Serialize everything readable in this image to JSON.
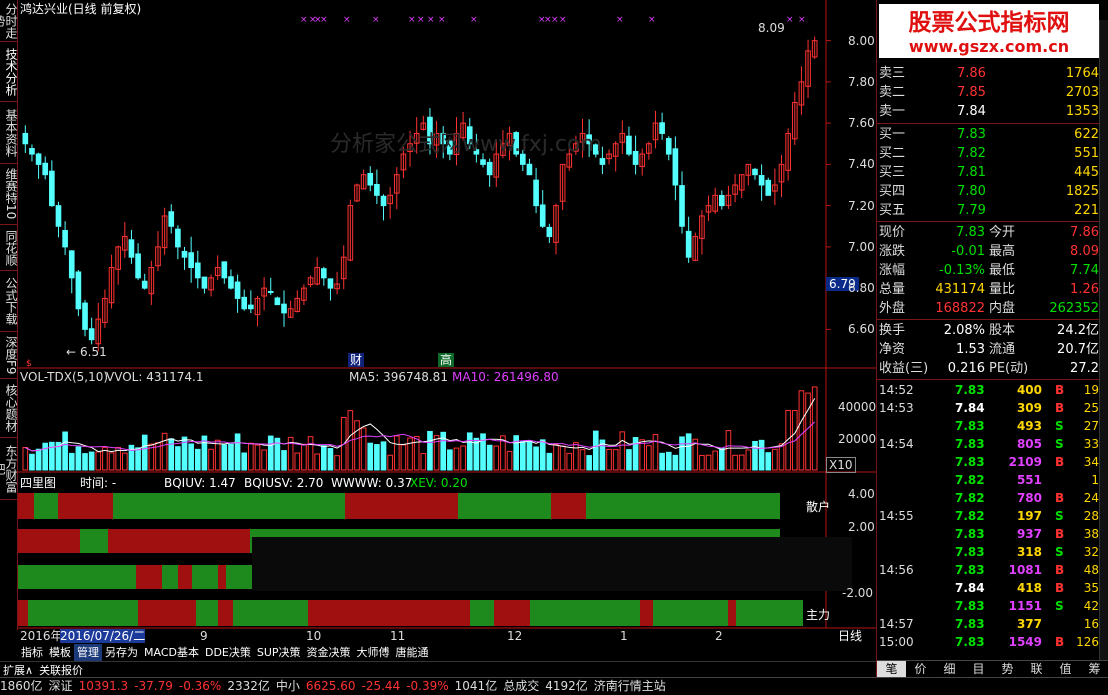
{
  "left_tabs": [
    "分时走势",
    "技术分析",
    "基本资料",
    "维赛特10",
    "同花顺",
    "公式下载",
    "深度F9",
    "核心题材",
    "东方财富吧"
  ],
  "chart_header": "鸿达兴业(日线 前复权)",
  "price_axis": [
    "8.00",
    "7.80",
    "7.60",
    "7.40",
    "7.20",
    "7.00",
    "6.80",
    "6.60"
  ],
  "current_price_label": "6.79",
  "high_label": "8.09",
  "low_label": "6.51",
  "watermark": "分析家公式网www.fxj.com",
  "event_markers": [
    "财",
    "高"
  ],
  "vol_header": {
    "name": "VOL-TDX(5,10)",
    "vvol": "VVOL: 431174.1",
    "ma5": "MA5: 396748.81",
    "ma10": "MA10: 261496.80"
  },
  "vol_axis": [
    "40000",
    "20000"
  ],
  "vol_scale": "X10",
  "sili_header": {
    "name": "四里图",
    "time": "时间: -",
    "bqiuv": "BQIUV: 1.47",
    "bqiusv": "BQIUSV: 2.70",
    "wwww": "WWWW: 0.37",
    "xev": "XEV: 0.20"
  },
  "sili_axis": [
    "4.00",
    "2.00",
    "-2.00"
  ],
  "sili_labels": [
    "散户",
    "主力"
  ],
  "date_axis": {
    "year": "2016年",
    "selected": "2016/07/26/二",
    "months": [
      "9",
      "10",
      "11",
      "12",
      "1",
      "2"
    ]
  },
  "period_label": "日线",
  "zoom_controls": [
    "+",
    "-",
    "0"
  ],
  "bottom_tabs": [
    "指标",
    "模板",
    "管理",
    "另存为",
    "MACD基本",
    "DDE决策",
    "SUP决策",
    "资金决策",
    "大师傅",
    "唐能通"
  ],
  "bottom_tabs2": [
    "扩展∧",
    "关联报价"
  ],
  "status_bar": [
    "1860亿",
    "深证",
    "10391.3",
    "-37.79",
    "-0.36%",
    "2332亿",
    "中小",
    "6625.60",
    "-25.44",
    "-0.39%",
    "1041亿",
    "总成交",
    "4192亿",
    "济南行情主站"
  ],
  "logo": {
    "title": "股票公式指标网",
    "url": "www.gszx.com.cn"
  },
  "asks": [
    {
      "label": "卖三",
      "price": "7.86",
      "vol": "1764"
    },
    {
      "label": "卖二",
      "price": "7.85",
      "vol": "2703"
    },
    {
      "label": "卖一",
      "price": "7.84",
      "vol": "1353"
    }
  ],
  "bids": [
    {
      "label": "买一",
      "price": "7.83",
      "vol": "622"
    },
    {
      "label": "买二",
      "price": "7.82",
      "vol": "551"
    },
    {
      "label": "买三",
      "price": "7.81",
      "vol": "445"
    },
    {
      "label": "买四",
      "price": "7.80",
      "vol": "1825"
    },
    {
      "label": "买五",
      "price": "7.79",
      "vol": "221"
    }
  ],
  "quote": [
    {
      "l1": "现价",
      "v1": "7.83",
      "l2": "今开",
      "v2": "7.86"
    },
    {
      "l1": "涨跌",
      "v1": "-0.01",
      "l2": "最高",
      "v2": "8.09"
    },
    {
      "l1": "涨幅",
      "v1": "-0.13%",
      "l2": "最低",
      "v2": "7.74"
    },
    {
      "l1": "总量",
      "v1": "431174",
      "l2": "量比",
      "v2": "1.26"
    },
    {
      "l1": "外盘",
      "v1": "168822",
      "l2": "内盘",
      "v2": "262352"
    }
  ],
  "fundamentals": [
    {
      "l1": "换手",
      "v1": "2.08%",
      "l2": "股本",
      "v2": "24.2亿"
    },
    {
      "l1": "净资",
      "v1": "1.53",
      "l2": "流通",
      "v2": "20.7亿"
    },
    {
      "l1": "收益(三)",
      "v1": "0.216",
      "l2": "PE(动)",
      "v2": "27.2"
    }
  ],
  "ticks": [
    {
      "time": "14:52",
      "price": "7.83",
      "vol": "400",
      "bs": "B",
      "n": "19"
    },
    {
      "time": "14:53",
      "price": "7.84",
      "vol": "309",
      "bs": "B",
      "n": "25"
    },
    {
      "time": "",
      "price": "7.83",
      "vol": "493",
      "bs": "S",
      "n": "27"
    },
    {
      "time": "14:54",
      "price": "7.83",
      "vol": "805",
      "bs": "S",
      "n": "33"
    },
    {
      "time": "",
      "price": "7.83",
      "vol": "2109",
      "bs": "B",
      "n": "34"
    },
    {
      "time": "",
      "price": "7.82",
      "vol": "551",
      "bs": "",
      "n": "1"
    },
    {
      "time": "",
      "price": "7.82",
      "vol": "780",
      "bs": "B",
      "n": "24"
    },
    {
      "time": "14:55",
      "price": "7.82",
      "vol": "197",
      "bs": "S",
      "n": "28"
    },
    {
      "time": "",
      "price": "7.83",
      "vol": "937",
      "bs": "B",
      "n": "38"
    },
    {
      "time": "",
      "price": "7.83",
      "vol": "318",
      "bs": "S",
      "n": "32"
    },
    {
      "time": "14:56",
      "price": "7.83",
      "vol": "1081",
      "bs": "B",
      "n": "48"
    },
    {
      "time": "",
      "price": "7.84",
      "vol": "418",
      "bs": "B",
      "n": "35"
    },
    {
      "time": "",
      "price": "7.83",
      "vol": "1151",
      "bs": "S",
      "n": "42"
    },
    {
      "time": "14:57",
      "price": "7.83",
      "vol": "377",
      "bs": "",
      "n": "16"
    },
    {
      "time": "15:00",
      "price": "7.83",
      "vol": "1549",
      "bs": "B",
      "n": "126"
    }
  ],
  "right_tabs": [
    "笔",
    "价",
    "细",
    "目",
    "势",
    "联",
    "值",
    "筹"
  ],
  "colors": {
    "up": "#ff3232",
    "down": "#54ffff",
    "green": "#00e000",
    "axis": "#b41414"
  },
  "chart_data": {
    "type": "candlestick",
    "x_range": [
      "2016/07/26",
      "2017/03"
    ],
    "ylim": [
      6.5,
      8.1
    ],
    "series": [
      {
        "name": "price_path",
        "values": [
          7.5,
          7.45,
          7.4,
          7.35,
          7.2,
          7.1,
          7.0,
          6.85,
          6.7,
          6.6,
          6.55,
          6.65,
          6.75,
          6.9,
          7.0,
          7.05,
          6.95,
          6.85,
          6.8,
          6.9,
          7.0,
          7.15,
          7.1,
          7.0,
          6.95,
          6.9,
          6.85,
          6.8,
          6.85,
          6.9,
          6.85,
          6.8,
          6.75,
          6.7,
          6.7,
          6.75,
          6.8,
          6.78,
          6.72,
          6.68,
          6.7,
          6.75,
          6.8,
          6.85,
          6.9,
          6.85,
          6.8,
          6.82,
          6.95,
          7.2,
          7.3,
          7.35,
          7.3,
          7.25,
          7.2,
          7.25,
          7.35,
          7.45,
          7.5,
          7.55,
          7.6,
          7.5,
          7.55,
          7.5,
          7.45,
          7.55,
          7.6,
          7.5,
          7.45,
          7.4,
          7.35,
          7.45,
          7.5,
          7.55,
          7.45,
          7.4,
          7.35,
          7.2,
          7.1,
          7.05,
          7.2,
          7.4,
          7.45,
          7.5,
          7.55,
          7.5,
          7.45,
          7.4,
          7.45,
          7.5,
          7.55,
          7.45,
          7.4,
          7.45,
          7.5,
          7.6,
          7.55,
          7.45,
          7.3,
          7.1,
          6.95,
          7.05,
          7.15,
          7.2,
          7.25,
          7.2,
          7.25,
          7.3,
          7.35,
          7.4,
          7.35,
          7.3,
          7.25,
          7.3,
          7.4,
          7.55,
          7.7,
          7.8,
          7.95,
          8.0
        ]
      }
    ]
  }
}
